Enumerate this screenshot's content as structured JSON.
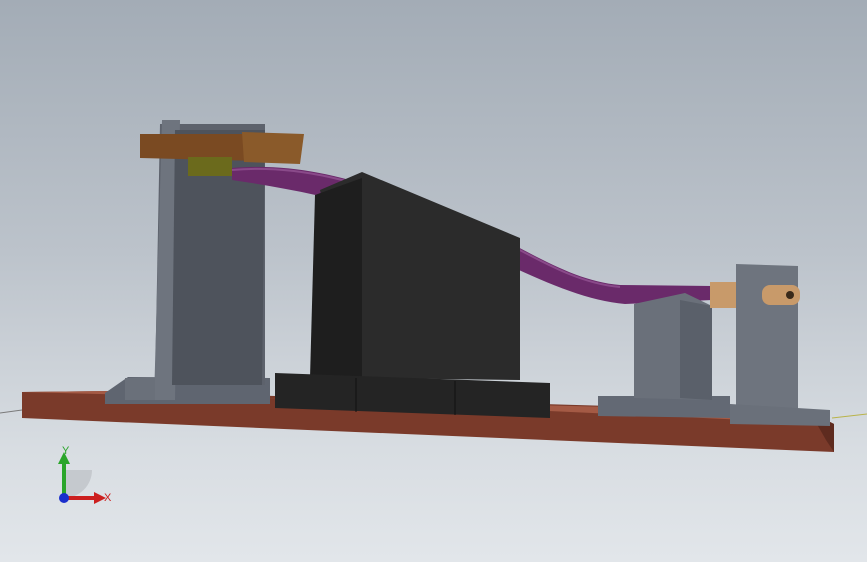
{
  "viewport": {
    "background_top": "#a3acb6",
    "background_bottom": "#e2e6ea"
  },
  "model": {
    "base_plate_color": "#7a3a2a",
    "fixture_block_color": "#6b717c",
    "support_block_color": "#2b2b2b",
    "bent_tube_color": "#6a2a6a",
    "wood_rod_color": "#7a4a22",
    "clamp_color": "#6b6a1c",
    "bushing_color": "#c89a6a"
  },
  "triad": {
    "x_label": "X",
    "y_label": "Y",
    "x_color": "#cc1f1f",
    "y_color": "#2aa52a",
    "z_color": "#1a2ecc"
  }
}
